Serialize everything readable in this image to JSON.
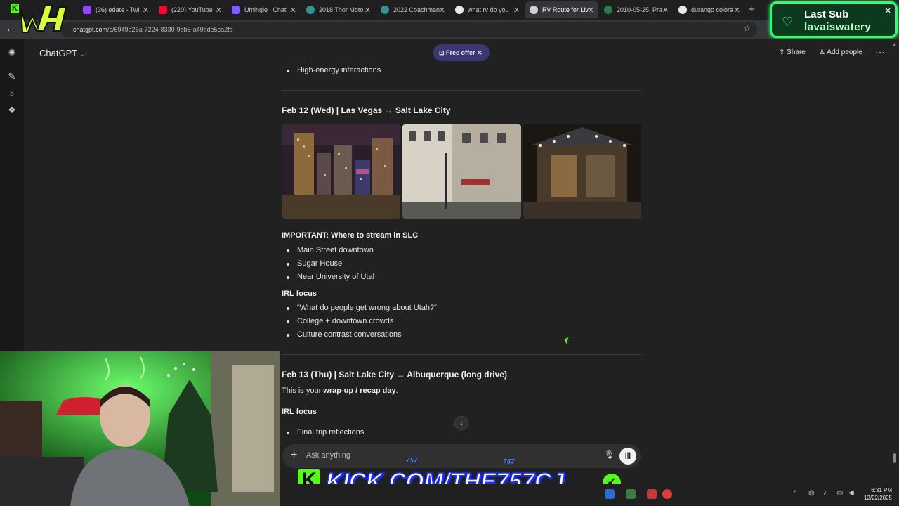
{
  "browser": {
    "tabs": [
      {
        "label": "(36) edate - Twi"
      },
      {
        "label": "(220) YouTube"
      },
      {
        "label": "Umingle | Chat"
      },
      {
        "label": "2018 Thor Moto"
      },
      {
        "label": "2022 Coachman"
      },
      {
        "label": "what rv do you"
      },
      {
        "label": "RV Route for Liv"
      },
      {
        "label": "2010-05-25_Pra"
      },
      {
        "label": "durango colora"
      }
    ],
    "url_host": "chatgpt.com",
    "url_path": "/c/6949d26a-7224-8330-9bb5-a49bde5ca2fd"
  },
  "overlay": {
    "last_sub_title": "Last Sub",
    "last_sub_name": "lavaiswatery",
    "kick_url": "KICK.COM/THE757CJ",
    "sticker": "757"
  },
  "header": {
    "brand": "ChatGPT",
    "offer": "Free offer",
    "share": "Share",
    "add_people": "Add people"
  },
  "chat": {
    "prev_item": "High-energy interactions",
    "day1": {
      "heading_prefix": "Feb 12 (Wed) | Las Vegas → ",
      "heading_link": "Salt Lake City",
      "important": "IMPORTANT: Where to stream in SLC",
      "spots": [
        "Main Street downtown",
        "Sugar House",
        "Near University of Utah"
      ],
      "focus_title": "IRL focus",
      "focus": [
        "“What do people get wrong about Utah?”",
        "College + downtown crowds",
        "Culture contrast conversations"
      ]
    },
    "day2": {
      "heading": "Feb 13 (Thu) | Salt Lake City → Albuquerque (long drive)",
      "intro_prefix": "This is your ",
      "intro_bold": "wrap-up / recap day",
      "intro_suffix": ".",
      "focus_title": "IRL focus",
      "first_item": "Final trip reflections"
    }
  },
  "composer": {
    "placeholder": "Ask anything"
  },
  "system": {
    "time": "6:31 PM",
    "date": "12/22/2025"
  }
}
